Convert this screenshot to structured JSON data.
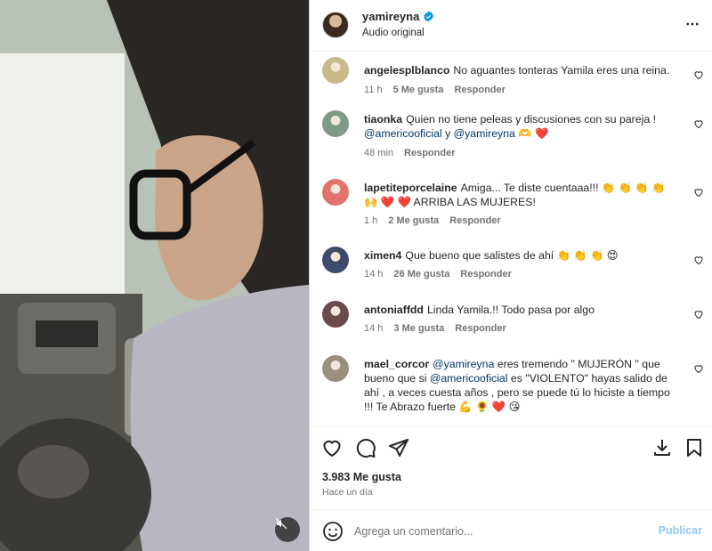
{
  "header": {
    "username": "yamireyna",
    "subtitle": "Audio original"
  },
  "comments": [
    {
      "user": "angelesplblanco",
      "parts": [
        {
          "t": "No aguantes tonteras Yamila eres una reina."
        }
      ],
      "time": "11 h",
      "likes": "5 Me gusta",
      "reply": "Responder",
      "avatar_color": "#c9b98a"
    },
    {
      "user": "tiaonka",
      "parts": [
        {
          "t": "Quien no tiene peleas y discusiones con su pareja ! "
        },
        {
          "t": "@americooficial",
          "m": true
        },
        {
          "t": " y "
        },
        {
          "t": "@yamireyna",
          "m": true
        },
        {
          "t": " 🫶 ❤️"
        }
      ],
      "time": "48 min",
      "likes": "",
      "reply": "Responder",
      "avatar_color": "#7f9a86"
    },
    {
      "user": "lapetiteporcelaine",
      "parts": [
        {
          "t": "Amiga... Te diste cuentaaa!!! 👏 👏 👏 👏 🙌 ❤️ ❤️ ARRIBA LAS MUJERES!"
        }
      ],
      "time": "1 h",
      "likes": "2 Me gusta",
      "reply": "Responder",
      "avatar_color": "#e0746d"
    },
    {
      "user": "ximen4",
      "parts": [
        {
          "t": "Que bueno que salistes de ahí 👏 👏 👏 😍"
        }
      ],
      "time": "14 h",
      "likes": "26 Me gusta",
      "reply": "Responder",
      "avatar_color": "#3d4a6b"
    },
    {
      "user": "antoniaffdd",
      "parts": [
        {
          "t": "Linda Yamila.!! Todo pasa por algo"
        }
      ],
      "time": "14 h",
      "likes": "3 Me gusta",
      "reply": "Responder",
      "avatar_color": "#6a4a4a"
    },
    {
      "user": "mael_corcor",
      "parts": [
        {
          "t": "@yamireyna",
          "m": true
        },
        {
          "t": " eres tremendo \" MUJERÓN \" que bueno que si "
        },
        {
          "t": "@americooficial",
          "m": true
        },
        {
          "t": " es \"VIOLENTO\" hayas salido de ahí , a veces cuesta años , pero se puede tú lo hiciste a tiempo !!! Te Abrazo fuerte 💪 🌻 ❤️ 😘"
        }
      ],
      "time": "",
      "likes": "",
      "reply": "",
      "avatar_color": "#9a8f7c"
    }
  ],
  "post": {
    "likes_count": "3.983 Me gusta",
    "posted_ago": "Hace un día"
  },
  "composer": {
    "placeholder": "Agrega un comentario...",
    "publish_label": "Publicar"
  },
  "icons": {
    "like": "heart-icon",
    "comment": "comment-icon",
    "share": "share-icon",
    "download": "download-icon",
    "save": "bookmark-icon",
    "more": "more-icon",
    "mute": "muted-speaker-icon",
    "emoji": "emoji-icon",
    "verified": "verified-badge-icon"
  },
  "colors": {
    "mention": "#00376b",
    "verified": "#0095f6",
    "publish_disabled": "#91c9f7",
    "secondary_text": "#737373"
  }
}
